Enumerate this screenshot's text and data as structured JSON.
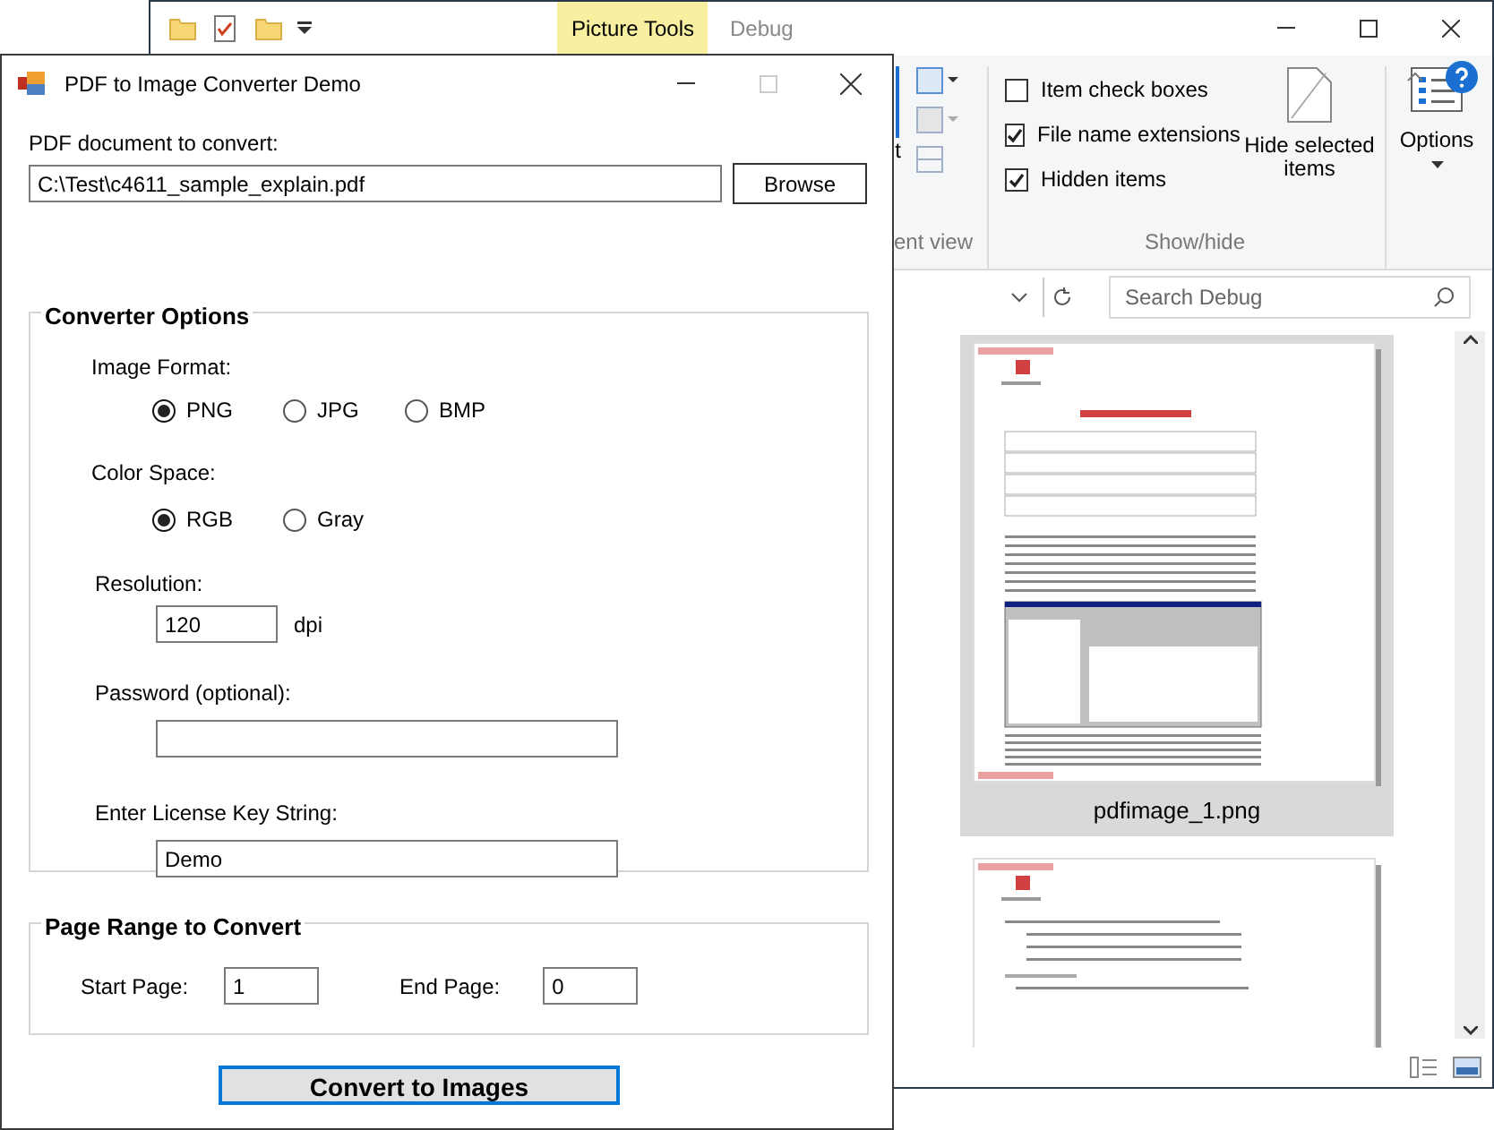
{
  "explorer": {
    "context_tab": "Picture Tools",
    "title": "Debug",
    "ribbon": {
      "cut_button_label": "t",
      "cut_group_label": "ent view",
      "checkboxes": [
        {
          "label": "Item check boxes",
          "checked": false
        },
        {
          "label": "File name extensions",
          "checked": true
        },
        {
          "label": "Hidden items",
          "checked": true
        }
      ],
      "hide_selected": "Hide selected items",
      "options": "Options",
      "group_label": "Show/hide"
    },
    "search": {
      "placeholder": "Search Debug"
    },
    "files": [
      {
        "name": "pdfimage_1.png",
        "selected": true
      },
      {
        "selected": false
      }
    ]
  },
  "dialog": {
    "title": "PDF to Image Converter Demo",
    "pdf_label": "PDF document to convert:",
    "pdf_path": "C:\\Test\\c4611_sample_explain.pdf",
    "browse": "Browse",
    "options_group": "Converter Options",
    "image_format": {
      "label": "Image Format:",
      "options": [
        {
          "label": "PNG",
          "selected": true
        },
        {
          "label": "JPG",
          "selected": false
        },
        {
          "label": "BMP",
          "selected": false
        }
      ]
    },
    "color_space": {
      "label": "Color Space:",
      "options": [
        {
          "label": "RGB",
          "selected": true
        },
        {
          "label": "Gray",
          "selected": false
        }
      ]
    },
    "resolution": {
      "label": "Resolution:",
      "value": "120",
      "unit": "dpi"
    },
    "password": {
      "label": "Password (optional):"
    },
    "license": {
      "label": "Enter License Key String:",
      "value": "Demo"
    },
    "range_group": "Page Range to Convert",
    "start_page": {
      "label": "Start Page:",
      "value": "1"
    },
    "end_page": {
      "label": "End Page:",
      "value": "0"
    },
    "convert": "Convert to Images"
  }
}
